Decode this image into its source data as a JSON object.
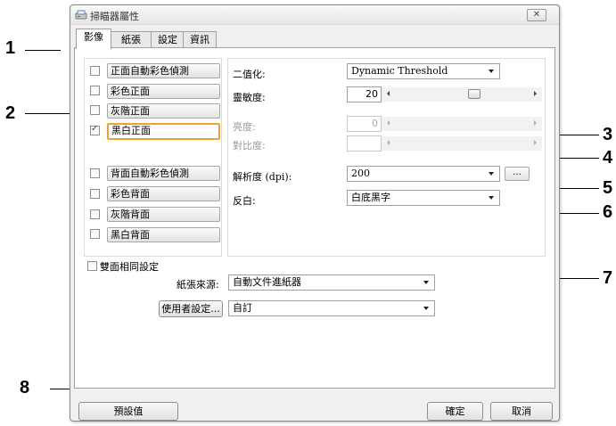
{
  "window": {
    "title": "掃瞄器屬性",
    "close_glyph": "✕",
    "title_icon": "scanner-icon"
  },
  "tabs": [
    {
      "label": "影像",
      "active": true
    },
    {
      "label": "紙張",
      "active": false
    },
    {
      "label": "設定",
      "active": false
    },
    {
      "label": "資訊",
      "active": false
    }
  ],
  "image_types": [
    {
      "label": "正面自動彩色偵測",
      "checked": false,
      "selected": false
    },
    {
      "label": "彩色正面",
      "checked": false,
      "selected": false
    },
    {
      "label": "灰階正面",
      "checked": false,
      "selected": false
    },
    {
      "label": "黑白正面",
      "checked": true,
      "selected": true
    },
    {
      "label": "背面自動彩色偵測",
      "checked": false,
      "selected": false
    },
    {
      "label": "彩色背面",
      "checked": false,
      "selected": false
    },
    {
      "label": "灰階背面",
      "checked": false,
      "selected": false
    },
    {
      "label": "黑白背面",
      "checked": false,
      "selected": false
    }
  ],
  "settings": {
    "binarization": {
      "label": "二值化:",
      "value": "Dynamic Threshold"
    },
    "sensitivity": {
      "label": "靈敏度:",
      "value": "20",
      "level": 0.6
    },
    "brightness": {
      "label": "亮度:",
      "value": "0",
      "enabled": false
    },
    "contrast": {
      "label": "對比度:",
      "value": "",
      "enabled": false
    },
    "resolution": {
      "label": "解析度 (dpi):",
      "value": "200",
      "more_label": "..."
    },
    "invert": {
      "label": "反白:",
      "value": "白底黑字"
    }
  },
  "duplex_same": {
    "label": "雙面相同設定",
    "checked": false
  },
  "paper_source": {
    "label": "紙張來源:",
    "value": "自動文件進紙器"
  },
  "user_settings": {
    "button_label": "使用者設定...",
    "value": "自訂"
  },
  "footer": {
    "default_label": "預設值",
    "ok_label": "確定",
    "cancel_label": "取消"
  },
  "callouts": [
    "1",
    "2",
    "3",
    "4",
    "5",
    "6",
    "7",
    "8"
  ]
}
